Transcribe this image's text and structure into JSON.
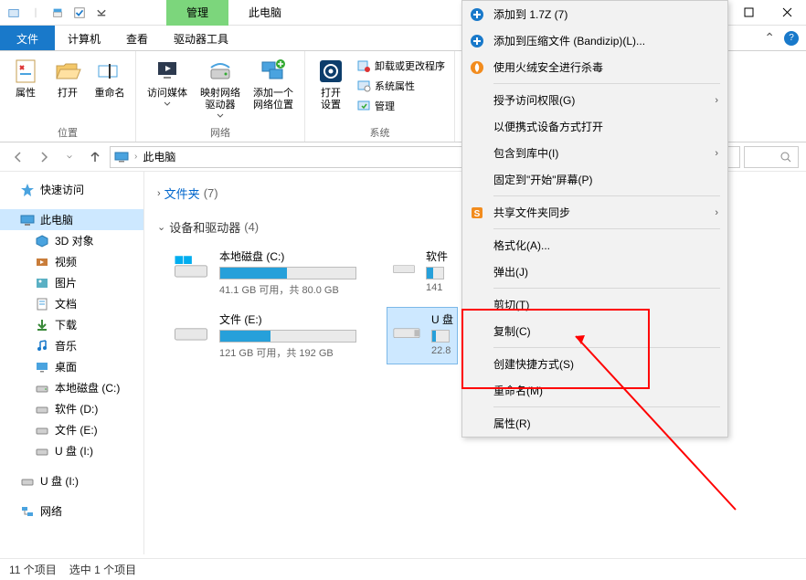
{
  "title": {
    "manage_tab": "管理",
    "window_label": "此电脑"
  },
  "ribbon_tabs": {
    "file": "文件",
    "computer": "计算机",
    "view": "查看",
    "drive_tools": "驱动器工具"
  },
  "ribbon": {
    "location": {
      "props": "属性",
      "open": "打开",
      "rename": "重命名",
      "group": "位置"
    },
    "network": {
      "access_media": "访问媒体",
      "map_drive": "映射网络\n驱动器",
      "add_loc": "添加一个\n网络位置",
      "group": "网络"
    },
    "system": {
      "open_settings": "打开\n设置",
      "uninstall": "卸载或更改程序",
      "sys_props": "系统属性",
      "manage": "管理",
      "group": "系统"
    }
  },
  "addr": {
    "label": "此电脑"
  },
  "sidebar": {
    "quick": "快速访问",
    "thispc": "此电脑",
    "objects3d": "3D 对象",
    "videos": "视频",
    "pictures": "图片",
    "documents": "文档",
    "downloads": "下载",
    "music": "音乐",
    "desktop": "桌面",
    "localc": "本地磁盘 (C:)",
    "soft_d": "软件 (D:)",
    "file_e": "文件 (E:)",
    "udisk_i": "U 盘 (I:)",
    "udisk_i2": "U 盘 (I:)",
    "network": "网络"
  },
  "content": {
    "folders_label": "文件夹",
    "folders_count": "(7)",
    "devices_label": "设备和驱动器",
    "devices_count": "(4)",
    "drives": [
      {
        "name": "本地磁盘 (C:)",
        "info": "41.1 GB 可用，共 80.0 GB",
        "fill": 49
      },
      {
        "name": "软件",
        "info": "141",
        "fill": 40
      },
      {
        "name": "文件 (E:)",
        "info": "121 GB 可用，共 192 GB",
        "fill": 37
      },
      {
        "name": "U 盘",
        "info": "22.8",
        "fill": 22
      }
    ]
  },
  "ctx": {
    "items": [
      {
        "label": "添加到 1.7Z (7)",
        "icon": "o-blue"
      },
      {
        "label": "添加到压缩文件 (Bandizip)(L)...",
        "icon": "o-blue"
      },
      {
        "label": "使用火绒安全进行杀毒",
        "icon": "o-orange"
      },
      {
        "sep": true
      },
      {
        "label": "授予访问权限(G)",
        "arrow": true
      },
      {
        "label": "以便携式设备方式打开"
      },
      {
        "label": "包含到库中(I)",
        "arrow": true
      },
      {
        "label": "固定到\"开始\"屏幕(P)"
      },
      {
        "sep": true
      },
      {
        "label": "共享文件夹同步",
        "icon": "s-orange",
        "arrow": true
      },
      {
        "sep": true
      },
      {
        "label": "格式化(A)..."
      },
      {
        "label": "弹出(J)"
      },
      {
        "sep": true
      },
      {
        "label": "剪切(T)"
      },
      {
        "label": "复制(C)"
      },
      {
        "sep": true
      },
      {
        "label": "创建快捷方式(S)"
      },
      {
        "label": "重命名(M)"
      },
      {
        "sep": true
      },
      {
        "label": "属性(R)"
      }
    ]
  },
  "status": {
    "items": "11 个项目",
    "selected": "选中 1 个项目"
  }
}
